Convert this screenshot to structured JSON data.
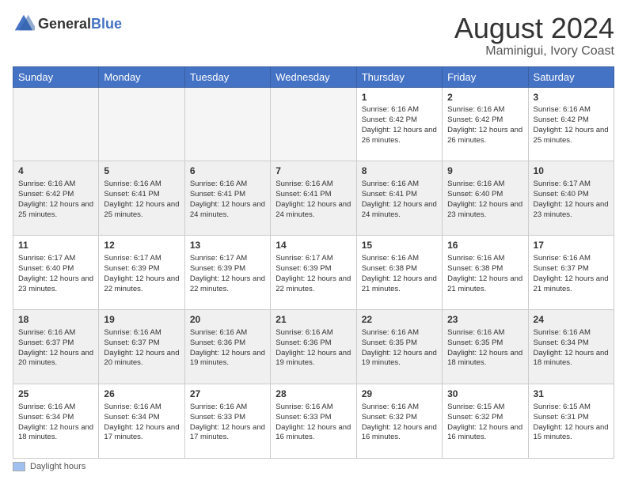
{
  "header": {
    "logo_general": "General",
    "logo_blue": "Blue",
    "main_title": "August 2024",
    "subtitle": "Maminigui, Ivory Coast"
  },
  "days_of_week": [
    "Sunday",
    "Monday",
    "Tuesday",
    "Wednesday",
    "Thursday",
    "Friday",
    "Saturday"
  ],
  "weeks": [
    {
      "cells": [
        {
          "day": "",
          "empty": true
        },
        {
          "day": "",
          "empty": true
        },
        {
          "day": "",
          "empty": true
        },
        {
          "day": "",
          "empty": true
        },
        {
          "day": "1",
          "sunrise": "Sunrise: 6:16 AM",
          "sunset": "Sunset: 6:42 PM",
          "daylight": "Daylight: 12 hours and 26 minutes."
        },
        {
          "day": "2",
          "sunrise": "Sunrise: 6:16 AM",
          "sunset": "Sunset: 6:42 PM",
          "daylight": "Daylight: 12 hours and 26 minutes."
        },
        {
          "day": "3",
          "sunrise": "Sunrise: 6:16 AM",
          "sunset": "Sunset: 6:42 PM",
          "daylight": "Daylight: 12 hours and 25 minutes."
        }
      ]
    },
    {
      "cells": [
        {
          "day": "4",
          "sunrise": "Sunrise: 6:16 AM",
          "sunset": "Sunset: 6:42 PM",
          "daylight": "Daylight: 12 hours and 25 minutes."
        },
        {
          "day": "5",
          "sunrise": "Sunrise: 6:16 AM",
          "sunset": "Sunset: 6:41 PM",
          "daylight": "Daylight: 12 hours and 25 minutes."
        },
        {
          "day": "6",
          "sunrise": "Sunrise: 6:16 AM",
          "sunset": "Sunset: 6:41 PM",
          "daylight": "Daylight: 12 hours and 24 minutes."
        },
        {
          "day": "7",
          "sunrise": "Sunrise: 6:16 AM",
          "sunset": "Sunset: 6:41 PM",
          "daylight": "Daylight: 12 hours and 24 minutes."
        },
        {
          "day": "8",
          "sunrise": "Sunrise: 6:16 AM",
          "sunset": "Sunset: 6:41 PM",
          "daylight": "Daylight: 12 hours and 24 minutes."
        },
        {
          "day": "9",
          "sunrise": "Sunrise: 6:16 AM",
          "sunset": "Sunset: 6:40 PM",
          "daylight": "Daylight: 12 hours and 23 minutes."
        },
        {
          "day": "10",
          "sunrise": "Sunrise: 6:17 AM",
          "sunset": "Sunset: 6:40 PM",
          "daylight": "Daylight: 12 hours and 23 minutes."
        }
      ]
    },
    {
      "cells": [
        {
          "day": "11",
          "sunrise": "Sunrise: 6:17 AM",
          "sunset": "Sunset: 6:40 PM",
          "daylight": "Daylight: 12 hours and 23 minutes."
        },
        {
          "day": "12",
          "sunrise": "Sunrise: 6:17 AM",
          "sunset": "Sunset: 6:39 PM",
          "daylight": "Daylight: 12 hours and 22 minutes."
        },
        {
          "day": "13",
          "sunrise": "Sunrise: 6:17 AM",
          "sunset": "Sunset: 6:39 PM",
          "daylight": "Daylight: 12 hours and 22 minutes."
        },
        {
          "day": "14",
          "sunrise": "Sunrise: 6:17 AM",
          "sunset": "Sunset: 6:39 PM",
          "daylight": "Daylight: 12 hours and 22 minutes."
        },
        {
          "day": "15",
          "sunrise": "Sunrise: 6:16 AM",
          "sunset": "Sunset: 6:38 PM",
          "daylight": "Daylight: 12 hours and 21 minutes."
        },
        {
          "day": "16",
          "sunrise": "Sunrise: 6:16 AM",
          "sunset": "Sunset: 6:38 PM",
          "daylight": "Daylight: 12 hours and 21 minutes."
        },
        {
          "day": "17",
          "sunrise": "Sunrise: 6:16 AM",
          "sunset": "Sunset: 6:37 PM",
          "daylight": "Daylight: 12 hours and 21 minutes."
        }
      ]
    },
    {
      "cells": [
        {
          "day": "18",
          "sunrise": "Sunrise: 6:16 AM",
          "sunset": "Sunset: 6:37 PM",
          "daylight": "Daylight: 12 hours and 20 minutes."
        },
        {
          "day": "19",
          "sunrise": "Sunrise: 6:16 AM",
          "sunset": "Sunset: 6:37 PM",
          "daylight": "Daylight: 12 hours and 20 minutes."
        },
        {
          "day": "20",
          "sunrise": "Sunrise: 6:16 AM",
          "sunset": "Sunset: 6:36 PM",
          "daylight": "Daylight: 12 hours and 19 minutes."
        },
        {
          "day": "21",
          "sunrise": "Sunrise: 6:16 AM",
          "sunset": "Sunset: 6:36 PM",
          "daylight": "Daylight: 12 hours and 19 minutes."
        },
        {
          "day": "22",
          "sunrise": "Sunrise: 6:16 AM",
          "sunset": "Sunset: 6:35 PM",
          "daylight": "Daylight: 12 hours and 19 minutes."
        },
        {
          "day": "23",
          "sunrise": "Sunrise: 6:16 AM",
          "sunset": "Sunset: 6:35 PM",
          "daylight": "Daylight: 12 hours and 18 minutes."
        },
        {
          "day": "24",
          "sunrise": "Sunrise: 6:16 AM",
          "sunset": "Sunset: 6:34 PM",
          "daylight": "Daylight: 12 hours and 18 minutes."
        }
      ]
    },
    {
      "cells": [
        {
          "day": "25",
          "sunrise": "Sunrise: 6:16 AM",
          "sunset": "Sunset: 6:34 PM",
          "daylight": "Daylight: 12 hours and 18 minutes."
        },
        {
          "day": "26",
          "sunrise": "Sunrise: 6:16 AM",
          "sunset": "Sunset: 6:34 PM",
          "daylight": "Daylight: 12 hours and 17 minutes."
        },
        {
          "day": "27",
          "sunrise": "Sunrise: 6:16 AM",
          "sunset": "Sunset: 6:33 PM",
          "daylight": "Daylight: 12 hours and 17 minutes."
        },
        {
          "day": "28",
          "sunrise": "Sunrise: 6:16 AM",
          "sunset": "Sunset: 6:33 PM",
          "daylight": "Daylight: 12 hours and 16 minutes."
        },
        {
          "day": "29",
          "sunrise": "Sunrise: 6:16 AM",
          "sunset": "Sunset: 6:32 PM",
          "daylight": "Daylight: 12 hours and 16 minutes."
        },
        {
          "day": "30",
          "sunrise": "Sunrise: 6:15 AM",
          "sunset": "Sunset: 6:32 PM",
          "daylight": "Daylight: 12 hours and 16 minutes."
        },
        {
          "day": "31",
          "sunrise": "Sunrise: 6:15 AM",
          "sunset": "Sunset: 6:31 PM",
          "daylight": "Daylight: 12 hours and 15 minutes."
        }
      ]
    }
  ],
  "legend": {
    "daylight_hours": "Daylight hours"
  },
  "colors": {
    "header_bg": "#4472c4",
    "shaded_row": "#f0f0f0",
    "white_row": "#ffffff"
  }
}
